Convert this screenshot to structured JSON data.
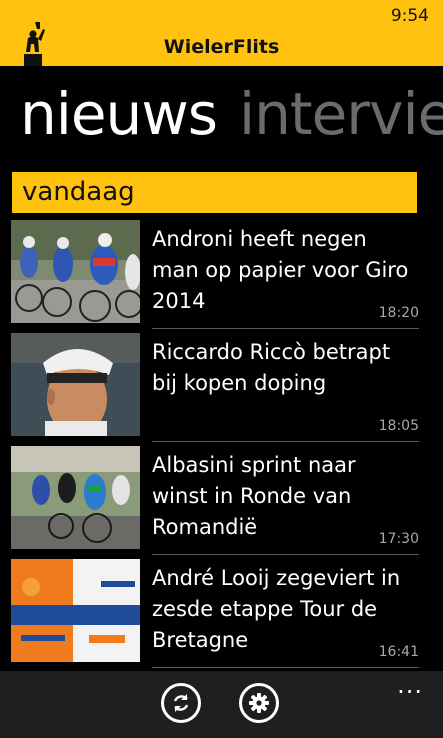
{
  "status_bar": {
    "time": "9:54"
  },
  "header": {
    "title": "WielerFlits",
    "accent_color": "#ffc20e"
  },
  "pivot": {
    "active": "nieuws",
    "next": "intervie"
  },
  "group": {
    "label": "vandaag"
  },
  "news": [
    {
      "title": "Androni heeft negen man op papier voor Giro 2014",
      "time": "18:20"
    },
    {
      "title": "Riccardo Riccò betrapt bij kopen doping",
      "time": "18:05"
    },
    {
      "title": "Albasini sprint naar winst in Ronde van Romandië",
      "time": "17:30"
    },
    {
      "title": "André Looij zegeviert in zesde etappe Tour de Bretagne",
      "time": "16:41"
    }
  ],
  "appbar": {
    "buttons": [
      {
        "icon": "refresh-icon"
      },
      {
        "icon": "gear-icon"
      }
    ],
    "more": "..."
  }
}
